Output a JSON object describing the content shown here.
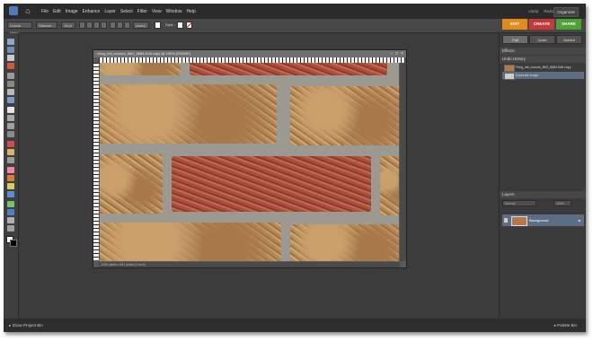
{
  "menubar": {
    "menus": [
      "File",
      "Edit",
      "Image",
      "Enhance",
      "Layer",
      "Select",
      "Filter",
      "View",
      "Window",
      "Help"
    ],
    "undo_label": "Undo",
    "redo_label": "Redo",
    "organizer_label": "Organizer"
  },
  "options": {
    "font_value": "Lucida Hand",
    "style_value": "Standar...",
    "size_value": "18 pt",
    "leading_value": "(Auto)",
    "style_label": "Style"
  },
  "mode_tabs": {
    "edit": "EDIT",
    "create": "CREATE",
    "share": "SHARE",
    "colors": {
      "edit": "#e38a1a",
      "create": "#c43a3a",
      "share": "#4fa236"
    }
  },
  "document": {
    "title": "Greg_Intl_colours_IMG_8684-Edit copy @ 100% (RGB/8*)",
    "status": "1260 pixels x 947 pixels (1 inch)"
  },
  "panel": {
    "segments": [
      "Full",
      "Quick",
      "Guided"
    ],
    "effects_header": "Effects",
    "undo_history_header": "Undo History",
    "history": [
      "Greg_Intl_colours_IMG_8684-Edit copy",
      "Duplicate Image"
    ],
    "layers_header": "Layers",
    "layers_blend": "Normal",
    "layers_opacity": "100%",
    "layers": [
      "Background"
    ]
  },
  "bottom": {
    "project_bin": "Show Project Bin",
    "palette_bin": "Palette Bin"
  }
}
